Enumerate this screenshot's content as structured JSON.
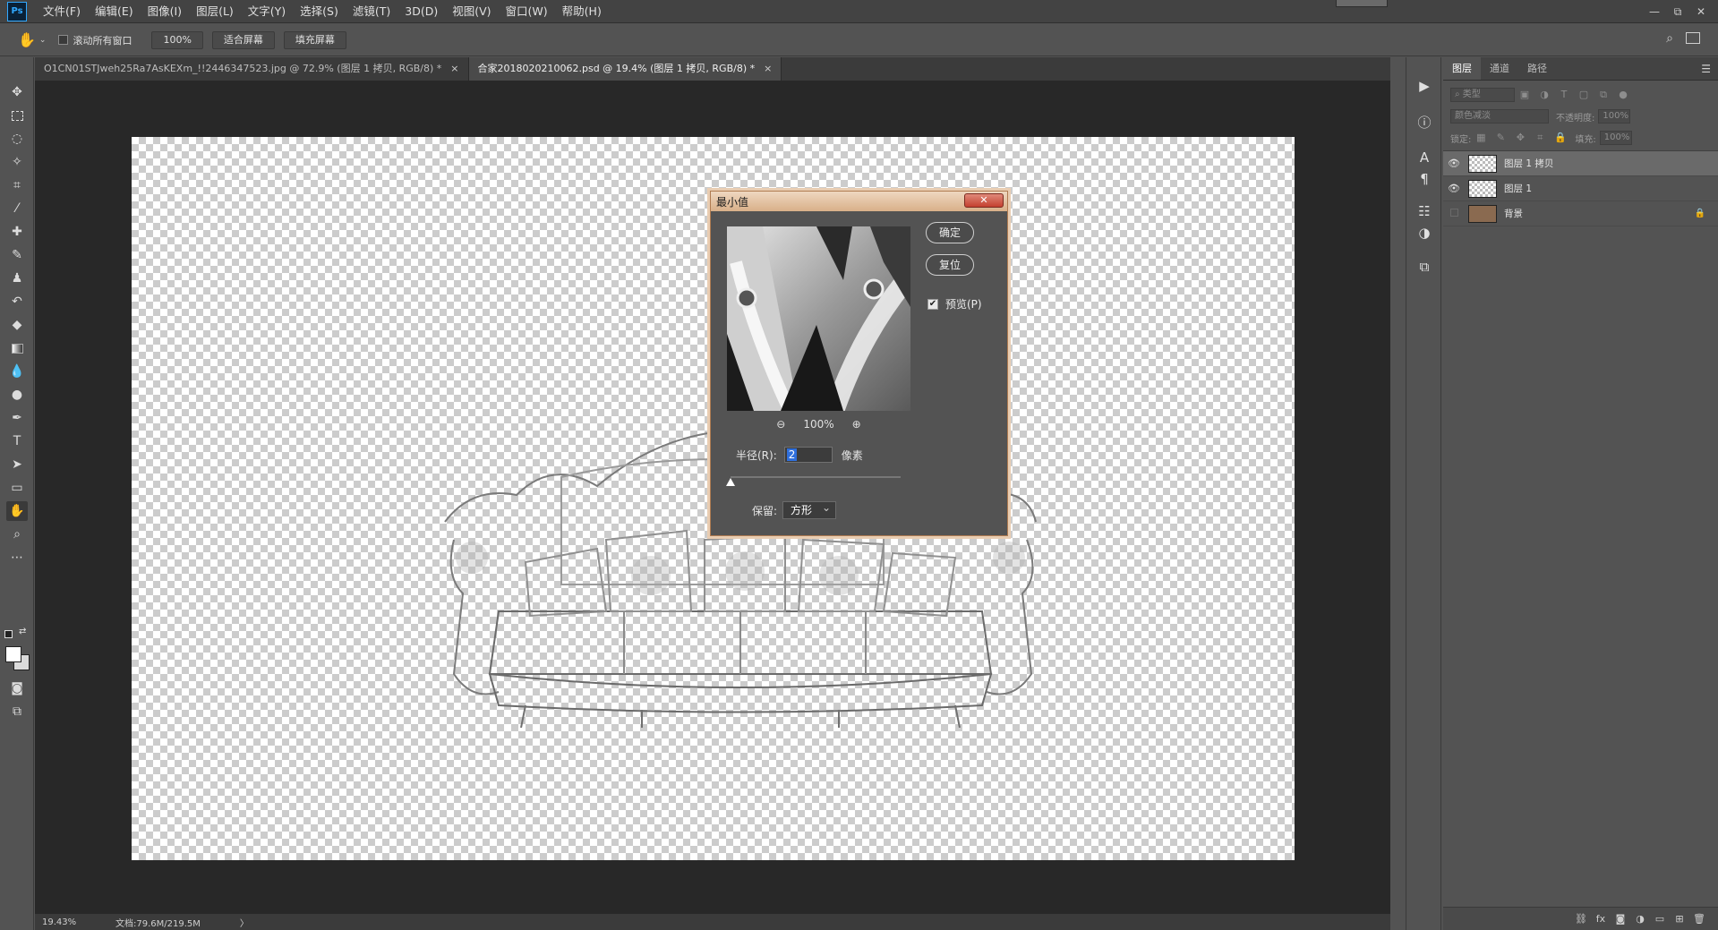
{
  "app": {
    "logo": "Ps",
    "menus": [
      "文件(F)",
      "编辑(E)",
      "图像(I)",
      "图层(L)",
      "文字(Y)",
      "选择(S)",
      "滤镜(T)",
      "3D(D)",
      "视图(V)",
      "窗口(W)",
      "帮助(H)"
    ],
    "window_controls": [
      "—",
      "⧉",
      "✕"
    ]
  },
  "options": {
    "tool_icon": "hand-icon",
    "scroll_all_label": "滚动所有窗口",
    "zoom_100": "100%",
    "fit_screen": "适合屏幕",
    "fill_screen": "填充屏幕"
  },
  "tabs": [
    {
      "label": "O1CN01STJweh25Ra7AsKEXm_!!2446347523.jpg @ 72.9% (图层 1 拷贝, RGB/8) *",
      "close": "×",
      "active": false
    },
    {
      "label": "合家2018020210062.psd @ 19.4% (图层 1 拷贝, RGB/8) *",
      "close": "×",
      "active": true
    }
  ],
  "status": {
    "zoom": "19.43%",
    "doc": "文档:79.6M/219.5M",
    "arrow": "〉"
  },
  "dialog": {
    "title": "最小值",
    "close": "✕",
    "ok": "确定",
    "reset": "复位",
    "preview_label": "预览(P)",
    "preview_checked": true,
    "zoom": "100%",
    "radius_label": "半径(R):",
    "radius_value": "2",
    "radius_unit": "像素",
    "keep_label": "保留:",
    "keep_value": "方形"
  },
  "panel": {
    "tabs": [
      "图层",
      "通道",
      "路径"
    ],
    "kind_label": "类型",
    "blend_mode": "颜色减淡",
    "opacity_label": "不透明度:",
    "opacity_value": "100%",
    "lock_label": "锁定:",
    "fill_label": "填充:",
    "fill_value": "100%",
    "layers": [
      {
        "name": "图层 1 拷贝",
        "visible": true,
        "selected": true,
        "locked": false
      },
      {
        "name": "图层 1",
        "visible": true,
        "selected": false,
        "locked": false
      },
      {
        "name": "背景",
        "visible": false,
        "selected": false,
        "locked": true
      }
    ]
  }
}
